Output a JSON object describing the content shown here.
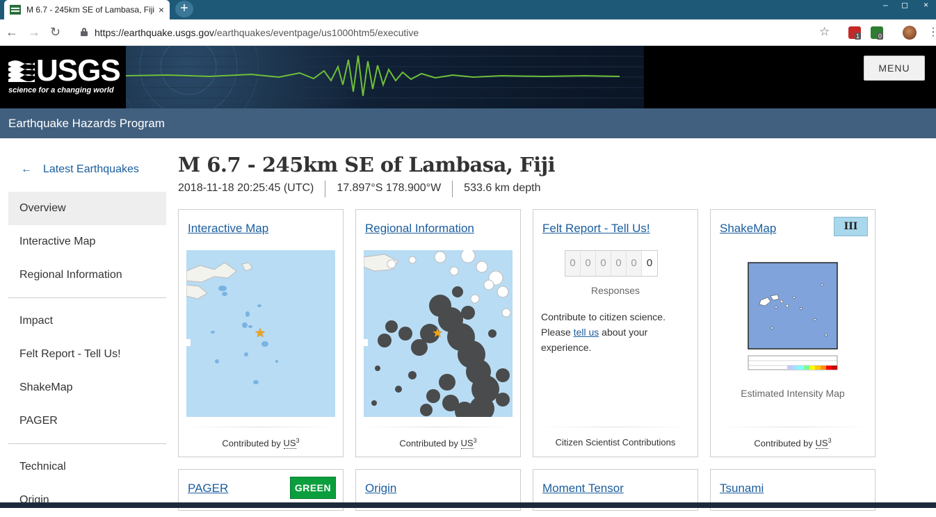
{
  "browser": {
    "tab_title": "M 6.7 - 245km SE of Lambasa, Fiji",
    "tab_close": "×",
    "new_tab": "+",
    "url_host": "https://earthquake.usgs.gov",
    "url_path": "/earthquakes/eventpage/us1000htm5/executive",
    "ext_badge_1": "1",
    "ext_badge_2": "0",
    "win_min": "‒",
    "win_max": "◻",
    "win_close": "×"
  },
  "header": {
    "logo_text": "USGS",
    "logo_tagline": "science for a changing world",
    "menu_label": "MENU",
    "program_title": "Earthquake Hazards Program"
  },
  "sidebar": {
    "back_label": "Latest Earthquakes",
    "group1": [
      "Overview",
      "Interactive Map",
      "Regional Information"
    ],
    "group2": [
      "Impact",
      "Felt Report - Tell Us!",
      "ShakeMap",
      "PAGER"
    ],
    "group3": [
      "Technical",
      "Origin"
    ]
  },
  "event": {
    "title": "M 6.7 - 245km SE of Lambasa, Fiji",
    "time": "2018-11-18 20:25:45 (UTC)",
    "location": "17.897°S 178.900°W",
    "depth": "533.6 km depth"
  },
  "cards": {
    "interactive_map": {
      "title": "Interactive Map",
      "foot_prefix": "Contributed by",
      "foot_abbr": "US",
      "foot_sup": "3"
    },
    "regional": {
      "title": "Regional Information",
      "foot_prefix": "Contributed by",
      "foot_abbr": "US",
      "foot_sup": "3"
    },
    "felt": {
      "title": "Felt Report - Tell Us!",
      "digits": [
        "0",
        "0",
        "0",
        "0",
        "0",
        "0"
      ],
      "responses_label": "Responses",
      "text_1": "Contribute to citizen science. Please ",
      "link": "tell us",
      "text_2": " about your experience.",
      "foot": "Citizen Scientist Contributions"
    },
    "shakemap": {
      "title": "ShakeMap",
      "mmi": "III",
      "caption": "Estimated Intensity Map",
      "foot_prefix": "Contributed by",
      "foot_abbr": "US",
      "foot_sup": "3"
    },
    "pager": {
      "title": "PAGER",
      "alert": "GREEN"
    },
    "origin": {
      "title": "Origin"
    },
    "moment_tensor": {
      "title": "Moment Tensor"
    },
    "tsunami": {
      "title": "Tsunami"
    }
  },
  "colors": {
    "link": "#1a5d9e",
    "program_bar": "#41607f",
    "pager_green": "#0a9e3d",
    "mmi_iii": "#a9d7eb",
    "ocean": "#b8dcf3"
  }
}
